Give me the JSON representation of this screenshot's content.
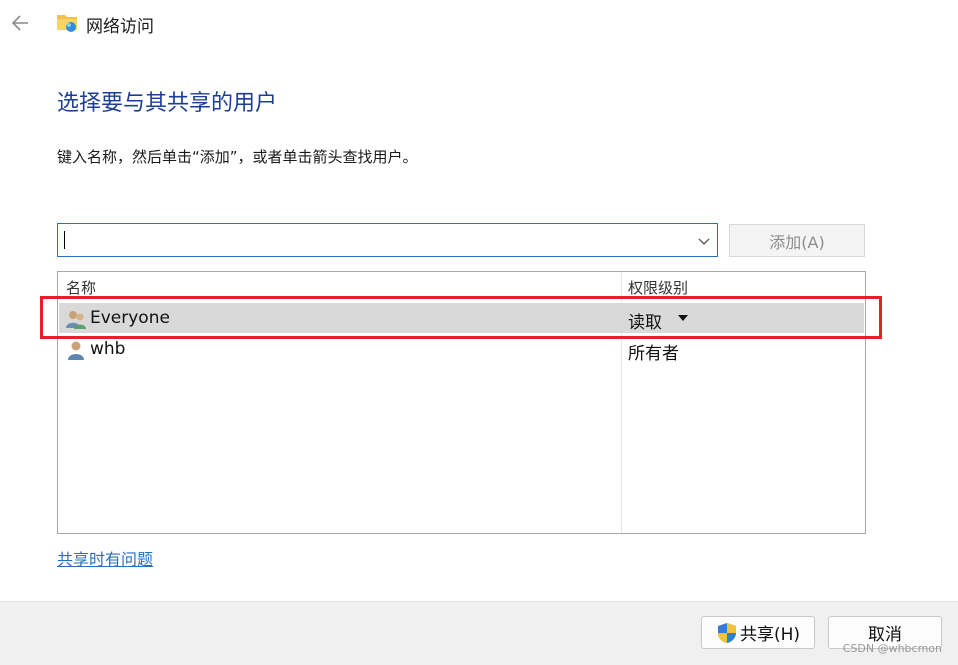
{
  "window": {
    "title": "网络访问",
    "back_icon": "back-arrow-icon",
    "app_icon": "network-share-icon"
  },
  "main": {
    "heading": "选择要与其共享的用户",
    "instructions": "键入名称，然后单击“添加”，或者单击箭头查找用户。",
    "name_input": {
      "value": "",
      "placeholder": ""
    },
    "add_button": "添加(A)"
  },
  "list": {
    "columns": [
      "名称",
      "权限级别"
    ],
    "rows": [
      {
        "name": "Everyone",
        "permission": "读取",
        "icon": "group-users-icon",
        "selected": true
      },
      {
        "name": "whb",
        "permission": "所有者",
        "icon": "user-icon",
        "selected": false
      }
    ]
  },
  "help_link": "共享时有问题",
  "footer": {
    "share_button": "共享(H)",
    "cancel_button": "取消"
  },
  "watermark": "CSDN @whbcmon",
  "colors": {
    "heading": "#1c3f93",
    "link": "#2a6fbd",
    "highlight": "#e0232b",
    "selected_row": "#d9d9d9"
  }
}
